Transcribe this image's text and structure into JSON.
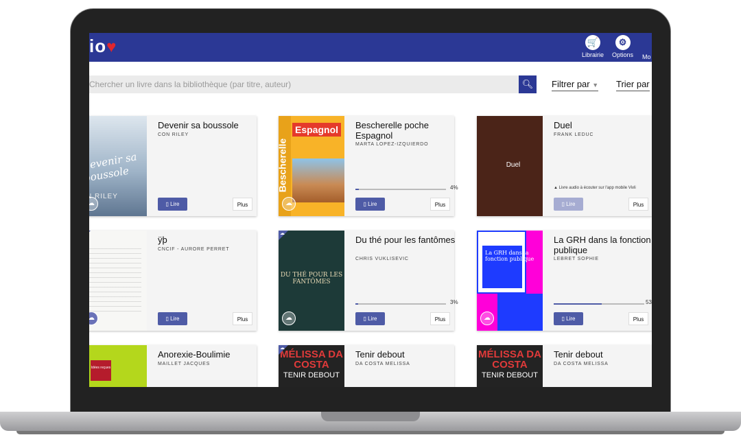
{
  "app": {
    "logo_text": "io",
    "logo_heart": "♥"
  },
  "header": {
    "nav": [
      {
        "label": "Librairie",
        "icon": "cart-icon",
        "glyph": "🛒"
      },
      {
        "label": "Options",
        "icon": "gear-icon",
        "glyph": "⚙"
      },
      {
        "label": "Mo",
        "icon": "more-icon",
        "glyph": ""
      }
    ]
  },
  "search": {
    "placeholder": "Chercher un livre dans la bibliothèque (par titre, auteur)",
    "button_icon": "search-icon"
  },
  "filters": {
    "filter_label": "Filtrer par",
    "sort_label": "Trier par"
  },
  "card_actions": {
    "read": "Lire",
    "more": "Plus"
  },
  "books": [
    {
      "title": "Devenir sa boussole",
      "author": "CON RILEY",
      "cover_text": "Devenir sa boussole",
      "cover_author": "N RILEY"
    },
    {
      "title": "Bescherelle poche Espagnol",
      "author": "MARTA LOPEZ-IZQUIERDO",
      "cover_text": "Espagnol",
      "cover_side": "Bescherelle",
      "progress": "4%"
    },
    {
      "title": "Duel",
      "author": "FRANK LEDUC",
      "cover_text": "Duel",
      "audio_note": "▲ Livre audio à écouter sur l'app mobile Vivli"
    },
    {
      "title": "ÿþ",
      "author": "CNCIF - AURORE PERRET"
    },
    {
      "title": "Du thé pour les fantômes",
      "author": "CHRIS VUKLISEVIC",
      "cover_text": "DU THÉ POUR LES FANTÔMES",
      "progress": "3%"
    },
    {
      "title": "La GRH dans la fonction publique",
      "author": "LEBRET SOPHIE",
      "cover_text": "La GRH dans la fonction publique",
      "progress": "53"
    },
    {
      "title": "Anorexie-Boulimie",
      "author": "MAILLET JACQUES",
      "cover_text": "Idées reçues"
    },
    {
      "title": "Tenir debout",
      "author": "DA COSTA MELISSA",
      "cover_text1": "MÉLISSA DA COSTA",
      "cover_text2": "TENIR DEBOUT"
    },
    {
      "title": "Tenir debout",
      "author": "DA COSTA MELISSA",
      "cover_text1": "MÉLISSA DA COSTA",
      "cover_text2": "TENIR DEBOUT"
    }
  ],
  "progress_fraction": {
    "book_2": 0.04,
    "book_5": 0.03,
    "book_6": 0.53
  },
  "colors": {
    "brand": "#2b3895",
    "accent": "#e1262d",
    "button": "#4e5ba6"
  }
}
